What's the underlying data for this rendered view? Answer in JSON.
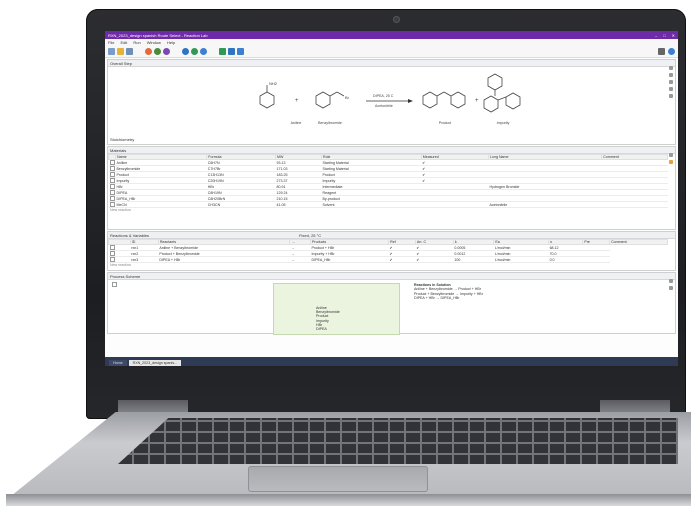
{
  "window": {
    "title": "RXN_2023_design spanish Route Select - Reaction Lab",
    "controls": [
      "–",
      "□",
      "✕"
    ]
  },
  "menu": [
    "File",
    "Edit",
    "Run",
    "Window",
    "Help"
  ],
  "toolbar": {
    "colors": [
      "#e46a3a",
      "#4a8a3c",
      "#7c47b5",
      "#2f74c0",
      "#2f9a54",
      "#3d7fd1"
    ]
  },
  "overall_step": {
    "title": "Overall Step",
    "reactant_1": "Aniline",
    "reactant_2": "Benzylbromide",
    "conditions_top": "DIPEA, 25 C",
    "conditions_bottom": "Acetonitrile",
    "product": "Product",
    "impurity": "Impurity",
    "stoich_label": "Stoichiometry"
  },
  "materials": {
    "title": "Materials",
    "columns": [
      "Name",
      "Formula",
      "MW",
      "Role",
      "Measured",
      "Long Name",
      "Comment"
    ],
    "rows": [
      [
        "Aniline",
        "C6H7N",
        "93.13",
        "Starting Material",
        "✔",
        "",
        ""
      ],
      [
        "Benzylbromide",
        "C7H7Br",
        "171.03",
        "Starting Material",
        "✔",
        "",
        ""
      ],
      [
        "Product",
        "C13H13N",
        "183.25",
        "Product",
        "✔",
        "",
        ""
      ],
      [
        "Impurity",
        "C20H19N",
        "273.37",
        "Impurity",
        "✔",
        "",
        ""
      ],
      [
        "HBr",
        "HBr",
        "80.91",
        "Intermediate",
        "",
        "Hydrogen Bromide",
        ""
      ],
      [
        "DIPEA",
        "C8H19N",
        "129.24",
        "Reagent",
        "",
        "",
        ""
      ],
      [
        "DIPEA_HBr",
        "C8H20BrN",
        "210.15",
        "By-product",
        "",
        "",
        ""
      ],
      [
        "MeCN",
        "CH3CN",
        "41.05",
        "Solvent",
        "",
        "Acetonitrile",
        ""
      ]
    ],
    "new_row": "New reaction"
  },
  "reactions": {
    "title": "Reactions & Variables",
    "group_label": "Fixed, 25 °C",
    "columns": [
      "",
      "ID",
      "Reactants",
      "→",
      "Products",
      "Ref",
      "Arr. C",
      "k",
      "Ea",
      "n",
      "Pre",
      "Comment"
    ],
    "rows": [
      [
        "rxn1",
        "Aniline + Benzylbromide",
        "→",
        "Product + HBr",
        "✔",
        "✔",
        "0.0005",
        "L/mol/min",
        "68.12",
        ""
      ],
      [
        "rxn2",
        "Product + Benzylbromide",
        "→",
        "Impurity + HBr",
        "✔",
        "✔",
        "0.0012",
        "L/mol/min",
        "70.0",
        ""
      ],
      [
        "rxn3",
        "DIPEA + HBr",
        "→",
        "DIPEA_HBr",
        "✔",
        "✔",
        "100",
        "L/mol/min",
        "0.0",
        ""
      ]
    ],
    "new_row": "New reaction"
  },
  "process": {
    "title": "Process Scheme",
    "charge_list": [
      "Aniline",
      "Benzylbromide",
      "Product",
      "Impurity",
      "HBr",
      "DIPEA"
    ],
    "notes_heading": "Reactions in Solution",
    "notes": [
      "Aniline + Benzylbromide → Product + HBr",
      "Product + Benzylbromide → Impurity + HBr",
      "DIPEA + HBr → DIPEA_HBr"
    ]
  },
  "status": {
    "tabs": [
      "Home",
      "RXN_2023_design spanis..."
    ]
  }
}
